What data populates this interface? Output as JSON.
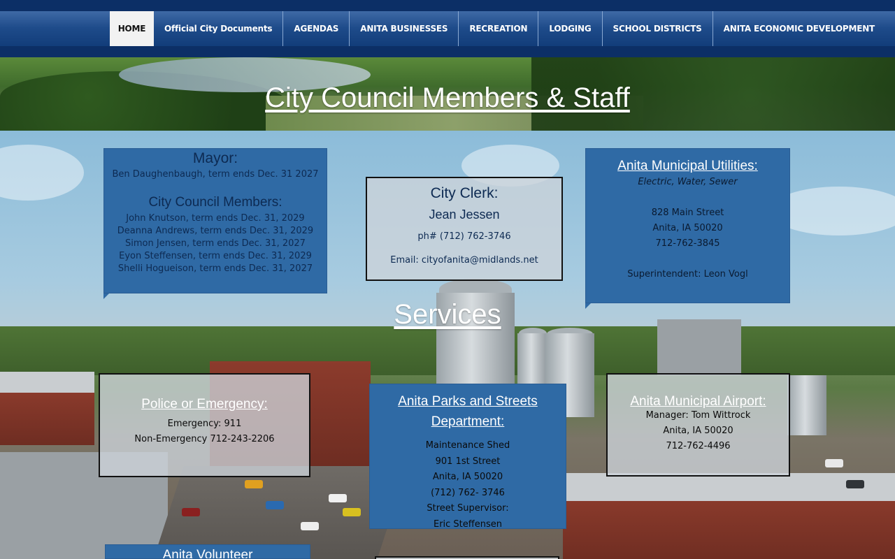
{
  "nav": {
    "items": [
      {
        "label": "HOME",
        "active": true
      },
      {
        "label": "Official City Documents"
      },
      {
        "label": "AGENDAS"
      },
      {
        "label": "ANITA BUSINESSES"
      },
      {
        "label": "RECREATION"
      },
      {
        "label": "LODGING"
      },
      {
        "label": "SCHOOL DISTRICTS"
      },
      {
        "label": "ANITA ECONOMIC DEVELOPMENT"
      }
    ]
  },
  "hero": {
    "title": "City Council Members & Staff"
  },
  "mayor": {
    "heading": "Mayor:",
    "name": "Ben Daughenbaugh, term ends Dec. 31 2027",
    "council_heading": "City Council Members:",
    "members": [
      "John Knutson, term ends Dec. 31, 2029",
      "Deanna Andrews, term ends Dec. 31, 2029",
      "Simon Jensen, term ends Dec. 31, 2027",
      "Eyon Steffensen, term ends Dec. 31, 2029",
      "Shelli Hogueison, term ends Dec. 31, 2027"
    ]
  },
  "clerk": {
    "heading": "City Clerk:",
    "name": "Jean Jessen",
    "phone": "ph# (712) 762-3746",
    "email": "Email:  cityofanita@midlands.net"
  },
  "utilities": {
    "heading": "Anita Municipal Utilities:",
    "subtitle": "Electric, Water, Sewer",
    "address1": "828 Main Street",
    "address2": "Anita, IA 50020",
    "phone": "712-762-3845",
    "superintendent": "Superintendent: Leon Vogl"
  },
  "services": {
    "title": "Services"
  },
  "police": {
    "heading": "Police or Emergency:",
    "emergency": "Emergency: 911",
    "non_emergency": "Non-Emergency 712-243-2206"
  },
  "parks": {
    "heading1": "Anita Parks and Streets",
    "heading2": "Department:",
    "lines": [
      "Maintenance Shed",
      "901 1st Street",
      "Anita, IA 50020",
      "(712) 762- 3746",
      "Street Supervisor:",
      "Eric Steffensen"
    ]
  },
  "airport": {
    "heading": "Anita Municipal Airport:",
    "manager": "Manager: Tom Wittrock",
    "address": "Anita, IA 50020",
    "phone": "712-762-4496"
  },
  "volunteer": {
    "heading": "Anita Volunteer"
  },
  "colors": {
    "nav": "#0c2f66",
    "card_blue": "#2f6aa5",
    "card_text": "#0d2a52"
  }
}
